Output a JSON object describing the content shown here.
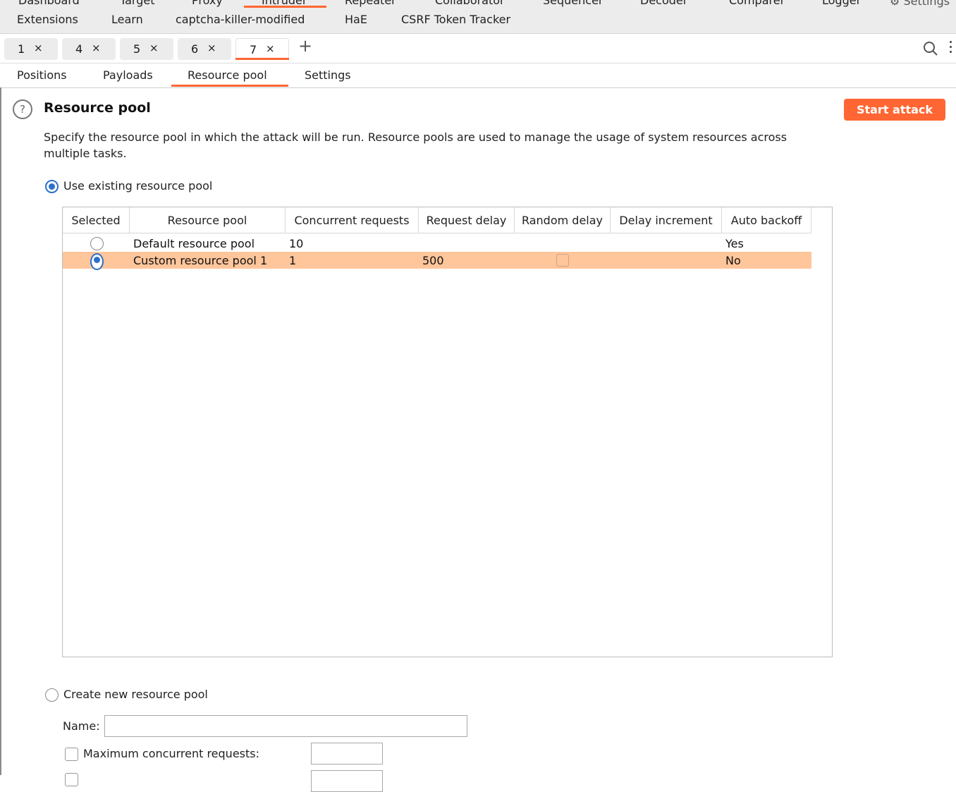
{
  "top_menu": [
    "Dashboard",
    "Target",
    "Proxy",
    "Intruder",
    "Repeater",
    "Collaborator",
    "Sequencer",
    "Decoder",
    "Comparer",
    "Logger"
  ],
  "settings_label": "Settings",
  "extension_tabs": [
    "Extensions",
    "Learn",
    "captcha-killer-modified",
    "HaE",
    "CSRF Token Tracker"
  ],
  "instance_tabs": [
    {
      "num": "1",
      "close": "×"
    },
    {
      "num": "4",
      "close": "×"
    },
    {
      "num": "5",
      "close": "×"
    },
    {
      "num": "6",
      "close": "×"
    },
    {
      "num": "7",
      "close": "×"
    }
  ],
  "add_tab": "+",
  "sub_tabs": [
    "Positions",
    "Payloads",
    "Resource pool",
    "Settings"
  ],
  "section": {
    "title": "Resource pool",
    "help": "?",
    "start_attack": "Start attack",
    "description": "Specify the resource pool in which the attack will be run. Resource pools are used to manage the usage of system resources across multiple tasks."
  },
  "use_existing_label": "Use existing resource pool",
  "table": {
    "headers": [
      "Selected",
      "Resource pool",
      "Concurrent requests",
      "Request delay",
      "Random delay",
      "Delay increment",
      "Auto backoff"
    ],
    "rows": [
      {
        "selected": false,
        "name": "Default resource pool",
        "concurrent": "10",
        "delay": "",
        "random": "",
        "increment": "",
        "backoff": "Yes"
      },
      {
        "selected": true,
        "name": "Custom resource pool 1",
        "concurrent": "1",
        "delay": "500",
        "random": "",
        "increment": "",
        "backoff": "No"
      }
    ]
  },
  "create_new_label": "Create new resource pool",
  "name_label": "Name:",
  "name_value": "",
  "max_concurrent_label": "Maximum concurrent requests:",
  "max_concurrent_value": "",
  "colors": {
    "accent": "#ff6633",
    "selected_row": "#ffc59b",
    "radio": "#2d6fc9"
  }
}
